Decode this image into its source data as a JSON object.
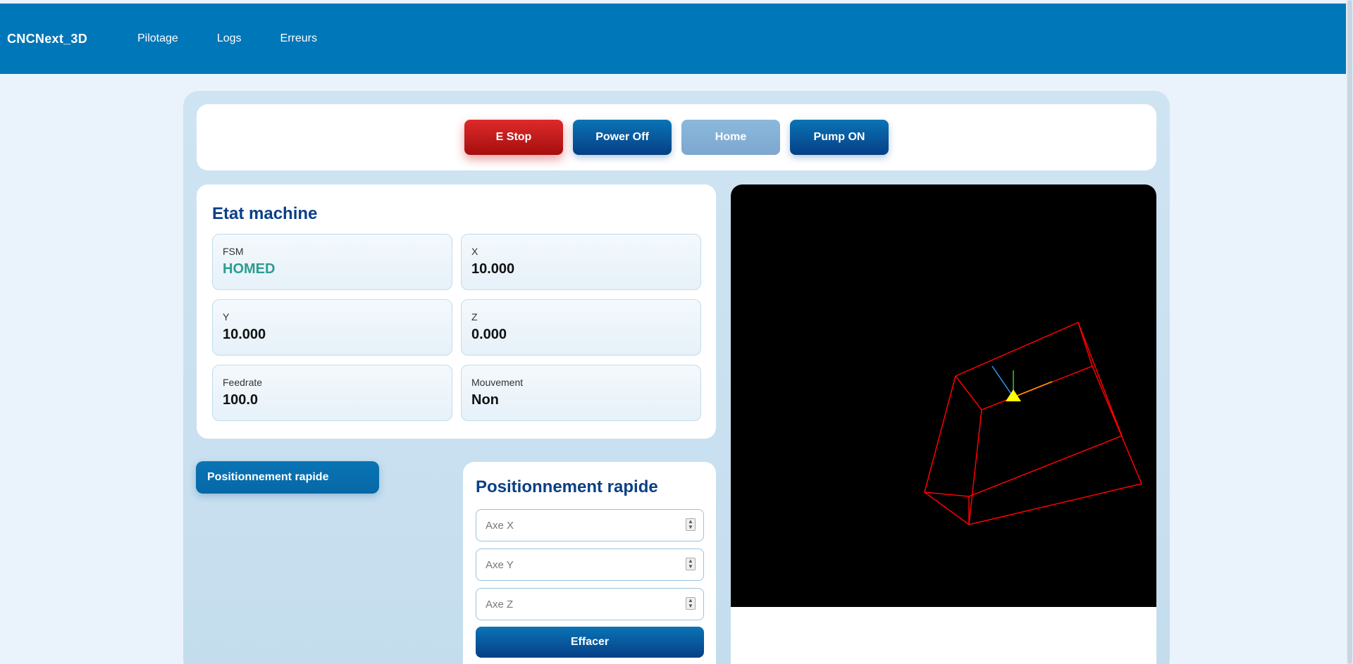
{
  "app": {
    "brand": "CNCNext_3D"
  },
  "nav": {
    "items": [
      {
        "label": "Pilotage"
      },
      {
        "label": "Logs"
      },
      {
        "label": "Erreurs"
      }
    ]
  },
  "controls": {
    "estop": "E Stop",
    "power": "Power Off",
    "home": "Home",
    "pump": "Pump ON"
  },
  "state": {
    "title": "Etat machine",
    "fields": [
      {
        "label": "FSM",
        "value": "HOMED"
      },
      {
        "label": "X",
        "value": "10.000"
      },
      {
        "label": "Y",
        "value": "10.000"
      },
      {
        "label": "Z",
        "value": "0.000"
      },
      {
        "label": "Feedrate",
        "value": "100.0"
      },
      {
        "label": "Mouvement",
        "value": "Non"
      }
    ]
  },
  "side_tab": {
    "label": "Positionnement rapide"
  },
  "positioning": {
    "title": "Positionnement rapide",
    "x_placeholder": "Axe X",
    "y_placeholder": "Axe Y",
    "z_placeholder": "Axe Z",
    "clear_label": "Effacer"
  },
  "colors": {
    "brand_blue": "#0077b8",
    "title_blue": "#0a3f86",
    "estop_red": "#c81e1e",
    "status_ok": "#2a9d8f",
    "wireframe": "#ff0000",
    "cursor": "#ffff00"
  }
}
